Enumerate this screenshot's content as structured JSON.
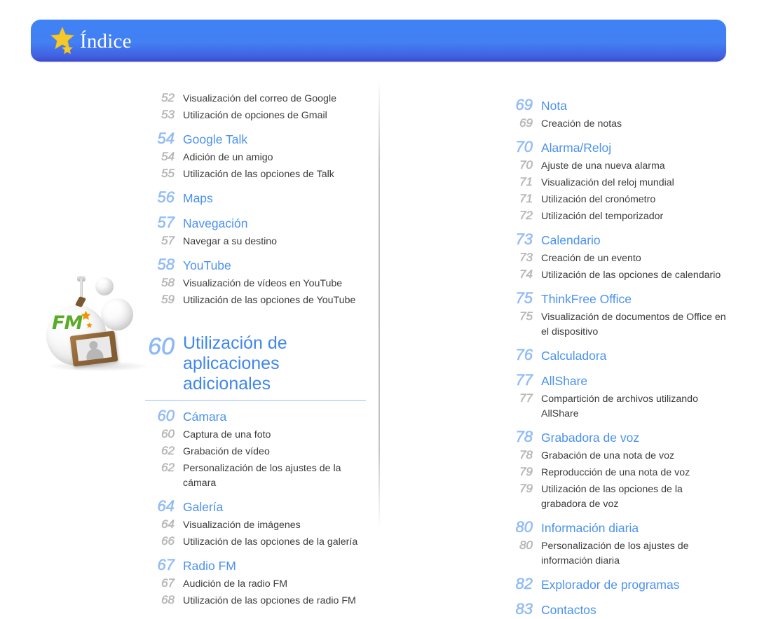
{
  "header": {
    "title": "Índice",
    "star_icon": "star-icon",
    "star_small_icon": "star-small-icon",
    "gradient_top": "#3f82f6",
    "gradient_bottom": "#3b49cc",
    "title_color": "#ffffff",
    "star_color": "#f5c125"
  },
  "colors": {
    "section_text": "#4b92f0",
    "section_page": "#93bcf7",
    "sub_text": "#3c3c3c",
    "sub_page": "#b8b8b8",
    "chapter_text": "#3f86ef",
    "chapter_rule": "#96c1f4"
  },
  "illustration": {
    "name": "fm-radio-illustration",
    "fm_label": "FM",
    "fm_color": "#5aab28",
    "star_color": "#f29400",
    "frame_color": "#8d6335"
  },
  "left_column": {
    "entries": [
      {
        "level": "sub",
        "page": "52",
        "text": "Visualización del correo de Google"
      },
      {
        "level": "sub",
        "page": "53",
        "text": "Utilización de opciones de Gmail"
      },
      {
        "level": "section",
        "page": "54",
        "text": "Google Talk"
      },
      {
        "level": "sub",
        "page": "54",
        "text": "Adición de un amigo"
      },
      {
        "level": "sub",
        "page": "55",
        "text": "Utilización de las opciones de Talk"
      },
      {
        "level": "section",
        "page": "56",
        "text": "Maps"
      },
      {
        "level": "section",
        "page": "57",
        "text": "Navegación"
      },
      {
        "level": "sub",
        "page": "57",
        "text": "Navegar a su destino"
      },
      {
        "level": "section",
        "page": "58",
        "text": "YouTube"
      },
      {
        "level": "sub",
        "page": "58",
        "text": "Visualización de vídeos en YouTube"
      },
      {
        "level": "sub",
        "page": "59",
        "text": "Utilización de las opciones de YouTube"
      }
    ],
    "chapter": {
      "page": "60",
      "title_line1": "Utilización de",
      "title_line2": "aplicaciones adicionales"
    },
    "chapter_entries": [
      {
        "level": "section",
        "page": "60",
        "text": "Cámara"
      },
      {
        "level": "sub",
        "page": "60",
        "text": "Captura de una foto"
      },
      {
        "level": "sub",
        "page": "62",
        "text": "Grabación de vídeo"
      },
      {
        "level": "sub",
        "page": "62",
        "text": "Personalización de los ajustes de la cámara"
      },
      {
        "level": "section",
        "page": "64",
        "text": "Galería"
      },
      {
        "level": "sub",
        "page": "64",
        "text": "Visualización de imágenes"
      },
      {
        "level": "sub",
        "page": "66",
        "text": "Utilización de las opciones de la galería"
      },
      {
        "level": "section",
        "page": "67",
        "text": "Radio FM"
      },
      {
        "level": "sub",
        "page": "67",
        "text": "Audición de la radio FM"
      },
      {
        "level": "sub",
        "page": "68",
        "text": "Utilización de las opciones de radio FM"
      }
    ]
  },
  "right_column": {
    "entries": [
      {
        "level": "section",
        "page": "69",
        "text": "Nota"
      },
      {
        "level": "sub",
        "page": "69",
        "text": "Creación de notas"
      },
      {
        "level": "section",
        "page": "70",
        "text": "Alarma/Reloj"
      },
      {
        "level": "sub",
        "page": "70",
        "text": "Ajuste de una nueva alarma"
      },
      {
        "level": "sub",
        "page": "71",
        "text": "Visualización del reloj mundial"
      },
      {
        "level": "sub",
        "page": "71",
        "text": "Utilización del cronómetro"
      },
      {
        "level": "sub",
        "page": "72",
        "text": "Utilización del temporizador"
      },
      {
        "level": "section",
        "page": "73",
        "text": "Calendario"
      },
      {
        "level": "sub",
        "page": "73",
        "text": "Creación de un evento"
      },
      {
        "level": "sub",
        "page": "74",
        "text": "Utilización de las opciones de calendario"
      },
      {
        "level": "section",
        "page": "75",
        "text": "ThinkFree Office"
      },
      {
        "level": "sub",
        "page": "75",
        "text": "Visualización de documentos de Office en el dispositivo"
      },
      {
        "level": "section",
        "page": "76",
        "text": "Calculadora"
      },
      {
        "level": "section",
        "page": "77",
        "text": "AllShare"
      },
      {
        "level": "sub",
        "page": "77",
        "text": "Compartición de archivos utilizando AllShare"
      },
      {
        "level": "section",
        "page": "78",
        "text": "Grabadora de voz"
      },
      {
        "level": "sub",
        "page": "78",
        "text": "Grabación de una nota de voz"
      },
      {
        "level": "sub",
        "page": "79",
        "text": "Reproducción de una nota de voz"
      },
      {
        "level": "sub",
        "page": "79",
        "text": "Utilización de las opciones de la grabadora de voz"
      },
      {
        "level": "section",
        "page": "80",
        "text": "Información diaria"
      },
      {
        "level": "sub",
        "page": "80",
        "text": "Personalización de los ajustes de información diaria"
      },
      {
        "level": "section",
        "page": "82",
        "text": "Explorador de programas"
      },
      {
        "level": "section",
        "page": "83",
        "text": "Contactos"
      }
    ]
  }
}
